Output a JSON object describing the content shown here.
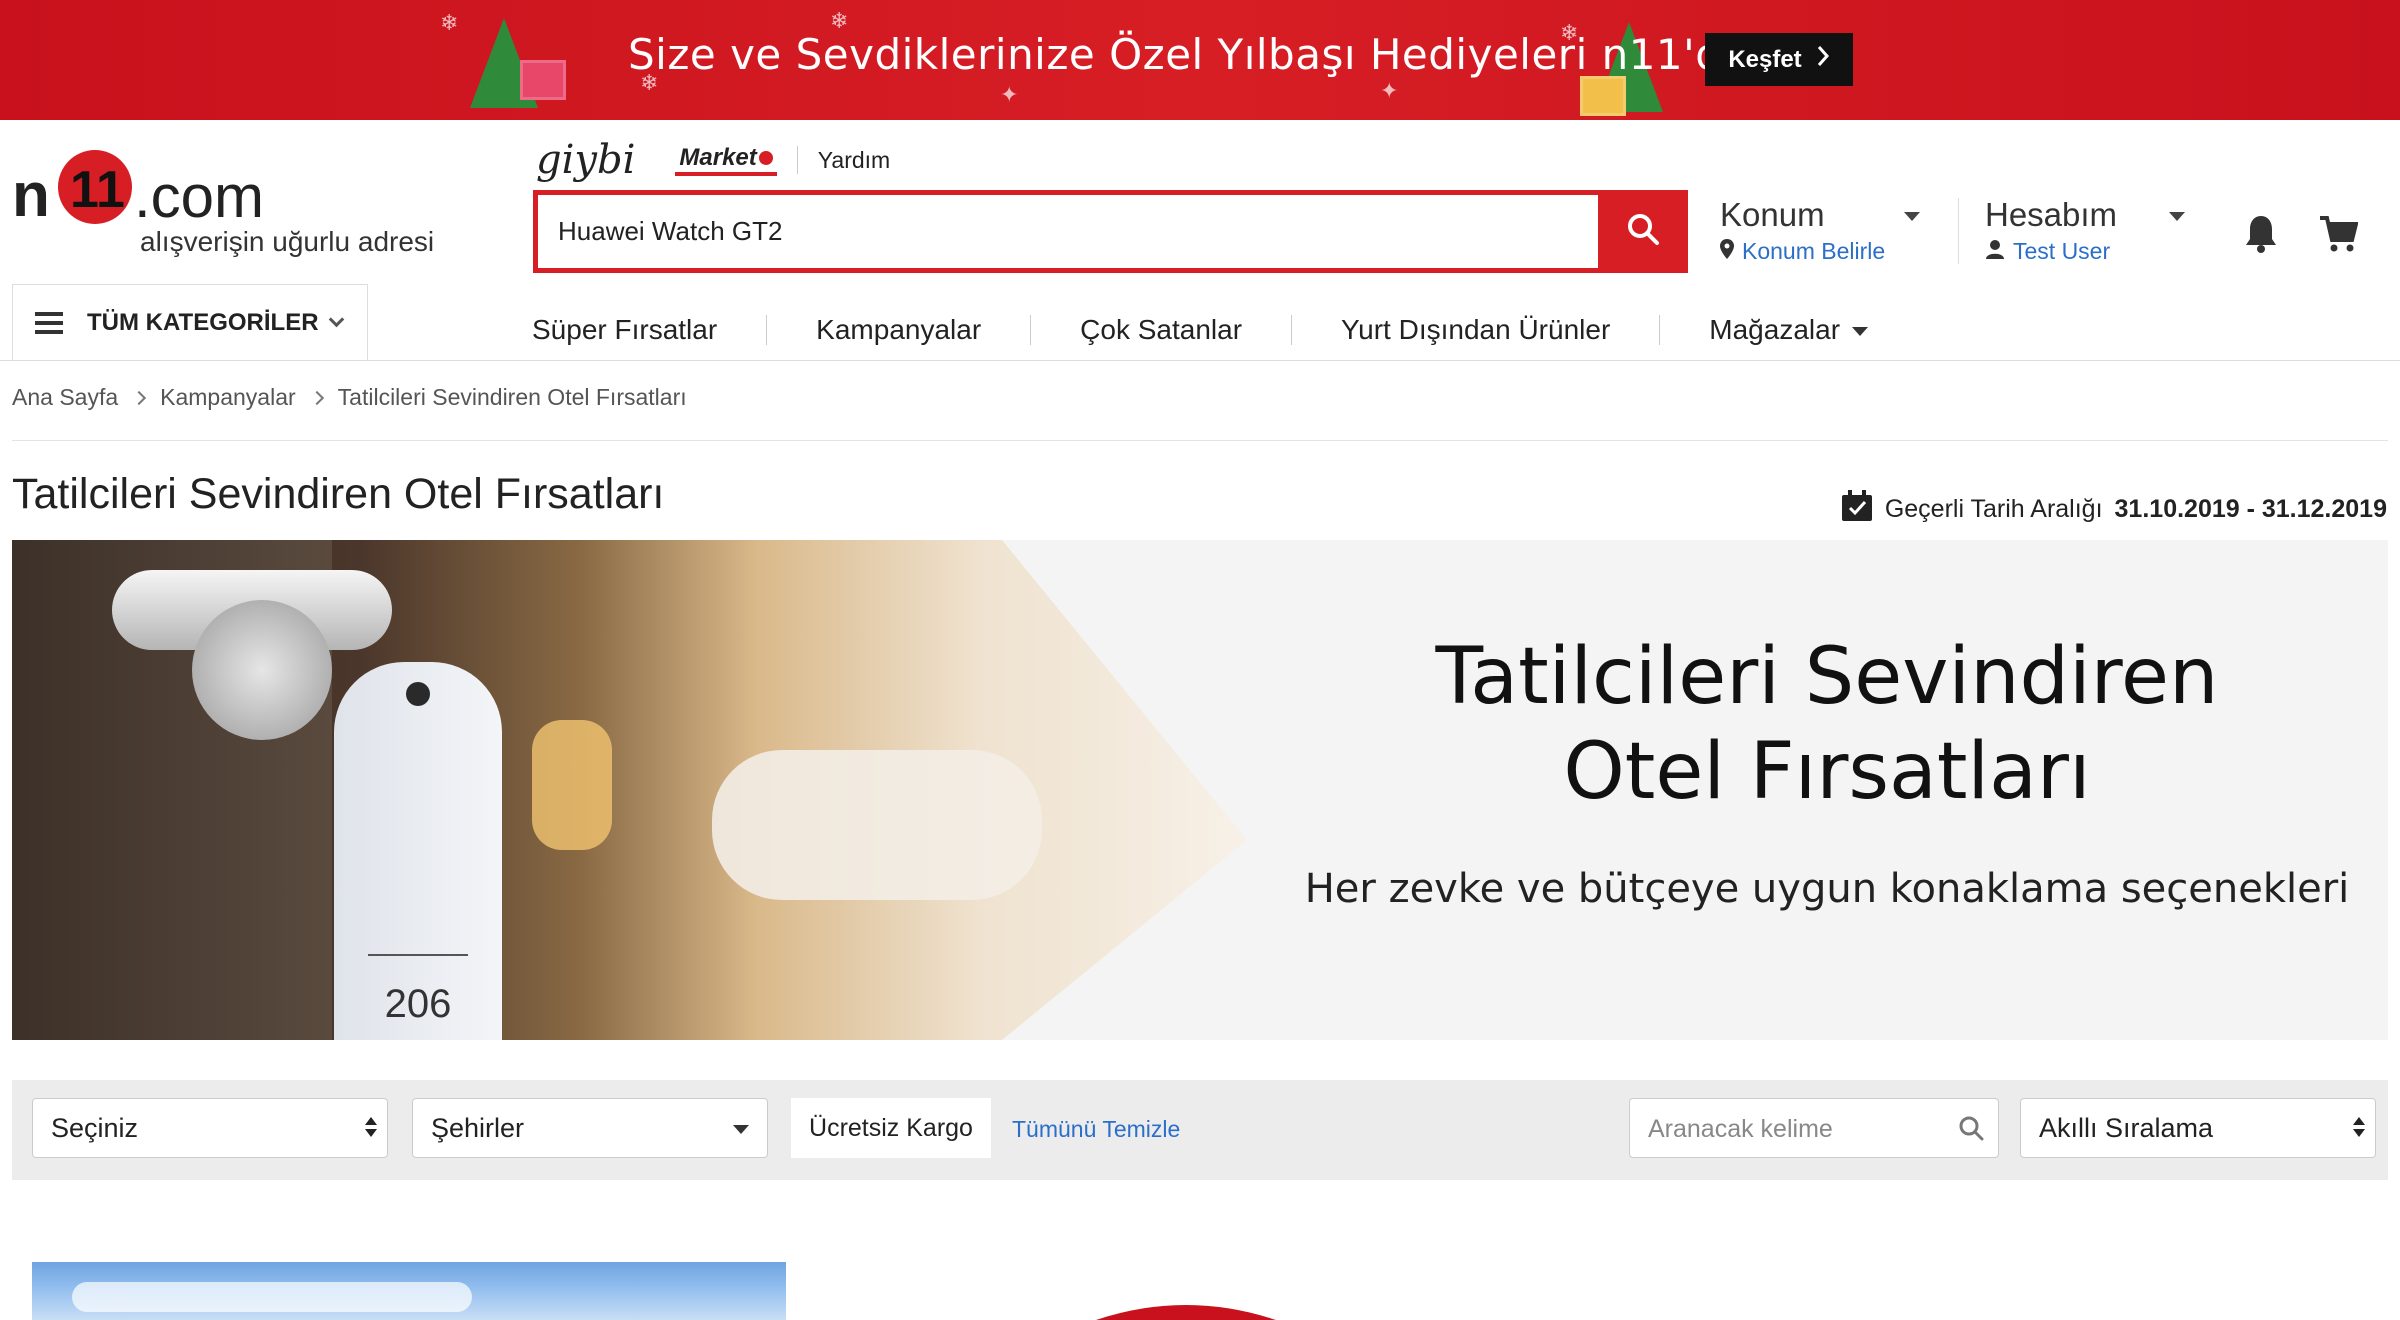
{
  "promo": {
    "title": "Size ve Sevdiklerinize Özel Yılbaşı Hediyeleri n11'de",
    "cta": "Keşfet",
    "colors": {
      "bg": "#d71e25",
      "cta_bg": "#111111"
    }
  },
  "brand": {
    "logo_n": "n",
    "logo_11": "11",
    "logo_com": ".com",
    "tagline": "alışverişin uğurlu adresi",
    "accent": "#d71e25",
    "link": "#2b6fc9"
  },
  "sublinks": {
    "giybi": "giybi",
    "market": "Market",
    "help": "Yardım"
  },
  "search": {
    "value": "Huawei Watch GT2",
    "icon": "search-icon"
  },
  "location": {
    "label": "Konum",
    "action": "Konum Belirle",
    "icon": "location-pin-icon"
  },
  "account": {
    "label": "Hesabım",
    "user": "Test User",
    "icon": "user-icon"
  },
  "icons": {
    "notifications": "bell-icon",
    "cart": "cart-icon",
    "calendar": "calendar-check-icon"
  },
  "categories": {
    "all_label": "TÜM KATEGORİLER",
    "menu": [
      "Süper Fırsatlar",
      "Kampanyalar",
      "Çok Satanlar",
      "Yurt Dışından Ürünler",
      "Mağazalar"
    ]
  },
  "breadcrumb": [
    "Ana Sayfa",
    "Kampanyalar",
    "Tatilcileri Sevindiren Otel Fırsatları"
  ],
  "page": {
    "title": "Tatilcileri Sevindiren Otel Fırsatları",
    "validity_label": "Geçerli Tarih Aralığı",
    "validity_range": "31.10.2019 - 31.12.2019"
  },
  "hero": {
    "heading_line1": "Tatilcileri Sevindiren",
    "heading_line2": "Otel Fırsatları",
    "subheading": "Her zevke ve bütçeye uygun konaklama seçenekleri",
    "room_number": "206"
  },
  "filters": {
    "select1": "Seçiniz",
    "cities": "Şehirler",
    "free_shipping": "Ücretsiz Kargo",
    "clear_all": "Tümünü Temizle",
    "keyword_placeholder": "Aranacak kelime",
    "sort": "Akıllı Sıralama"
  }
}
